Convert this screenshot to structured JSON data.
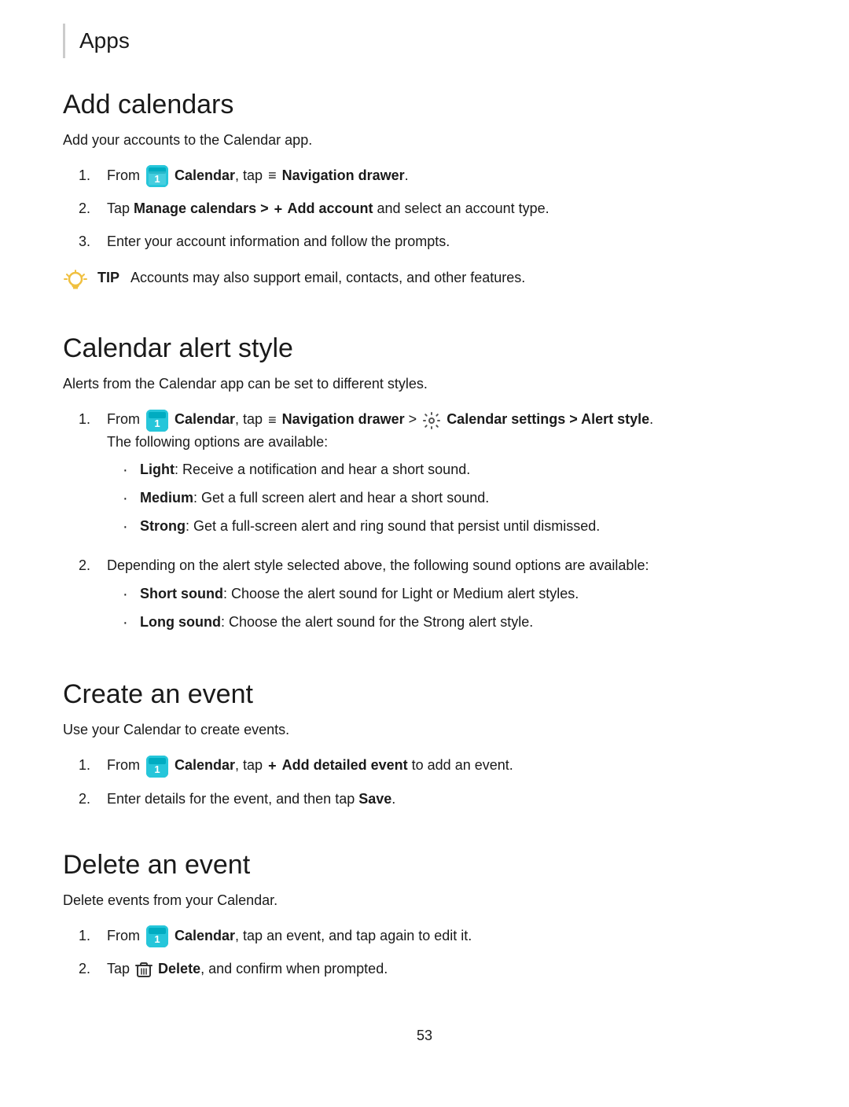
{
  "header": {
    "title": "Apps",
    "border_color": "#cccccc"
  },
  "sections": [
    {
      "id": "add-calendars",
      "title": "Add calendars",
      "description": "Add your accounts to the Calendar app.",
      "steps": [
        {
          "num": "1.",
          "parts": [
            {
              "type": "text",
              "value": "From "
            },
            {
              "type": "calendar-icon",
              "value": "1"
            },
            {
              "type": "bold",
              "value": " Calendar"
            },
            {
              "type": "text",
              "value": ", tap "
            },
            {
              "type": "nav-icon",
              "value": "≡"
            },
            {
              "type": "bold",
              "value": " Navigation drawer"
            },
            {
              "type": "text",
              "value": "."
            }
          ]
        },
        {
          "num": "2.",
          "parts": [
            {
              "type": "text",
              "value": "Tap "
            },
            {
              "type": "bold",
              "value": "Manage calendars > "
            },
            {
              "type": "add-icon",
              "value": "+"
            },
            {
              "type": "bold",
              "value": " Add account"
            },
            {
              "type": "text",
              "value": " and select an account type."
            }
          ]
        },
        {
          "num": "3.",
          "parts": [
            {
              "type": "text",
              "value": "Enter your account information and follow the prompts."
            }
          ]
        }
      ],
      "tip": {
        "show": true,
        "text": "Accounts may also support email, contacts, and other features."
      }
    },
    {
      "id": "calendar-alert-style",
      "title": "Calendar alert style",
      "description": "Alerts from the Calendar app can be set to different styles.",
      "steps": [
        {
          "num": "1.",
          "main_parts": [
            {
              "type": "text",
              "value": "From "
            },
            {
              "type": "calendar-icon",
              "value": "1"
            },
            {
              "type": "bold",
              "value": " Calendar"
            },
            {
              "type": "text",
              "value": ", tap "
            },
            {
              "type": "nav-icon",
              "value": "≡"
            },
            {
              "type": "bold",
              "value": " Navigation drawer"
            },
            {
              "type": "text",
              "value": " > "
            },
            {
              "type": "settings-icon"
            },
            {
              "type": "bold",
              "value": " Calendar settings > Alert style"
            },
            {
              "type": "text",
              "value": "."
            }
          ],
          "sub_text": "The following options are available:",
          "bullets": [
            {
              "label": "Light",
              "text": ": Receive a notification and hear a short sound."
            },
            {
              "label": "Medium",
              "text": ": Get a full screen alert and hear a short sound."
            },
            {
              "label": "Strong",
              "text": ": Get a full-screen alert and ring sound that persist until dismissed."
            }
          ]
        },
        {
          "num": "2.",
          "main_text": "Depending on the alert style selected above, the following sound options are available:",
          "bullets": [
            {
              "label": "Short sound",
              "text": ": Choose the alert sound for Light or Medium alert styles."
            },
            {
              "label": "Long sound",
              "text": ": Choose the alert sound for the Strong alert style."
            }
          ]
        }
      ]
    },
    {
      "id": "create-an-event",
      "title": "Create an event",
      "description": "Use your Calendar to create events.",
      "steps": [
        {
          "num": "1.",
          "parts": [
            {
              "type": "text",
              "value": "From "
            },
            {
              "type": "calendar-icon",
              "value": "1"
            },
            {
              "type": "bold",
              "value": " Calendar"
            },
            {
              "type": "text",
              "value": ", tap "
            },
            {
              "type": "add-icon",
              "value": "+"
            },
            {
              "type": "bold",
              "value": " Add detailed event"
            },
            {
              "type": "text",
              "value": " to add an event."
            }
          ]
        },
        {
          "num": "2.",
          "parts": [
            {
              "type": "text",
              "value": "Enter details for the event, and then tap "
            },
            {
              "type": "bold",
              "value": "Save"
            },
            {
              "type": "text",
              "value": "."
            }
          ]
        }
      ]
    },
    {
      "id": "delete-an-event",
      "title": "Delete an event",
      "description": "Delete events from your Calendar.",
      "steps": [
        {
          "num": "1.",
          "parts": [
            {
              "type": "text",
              "value": "From "
            },
            {
              "type": "calendar-icon",
              "value": "1"
            },
            {
              "type": "bold",
              "value": " Calendar"
            },
            {
              "type": "text",
              "value": ", tap an event, and tap again to edit it."
            }
          ]
        },
        {
          "num": "2.",
          "parts": [
            {
              "type": "text",
              "value": "Tap "
            },
            {
              "type": "trash-icon"
            },
            {
              "type": "bold",
              "value": " Delete"
            },
            {
              "type": "text",
              "value": ", and confirm when prompted."
            }
          ]
        }
      ]
    }
  ],
  "footer": {
    "page_number": "53"
  }
}
